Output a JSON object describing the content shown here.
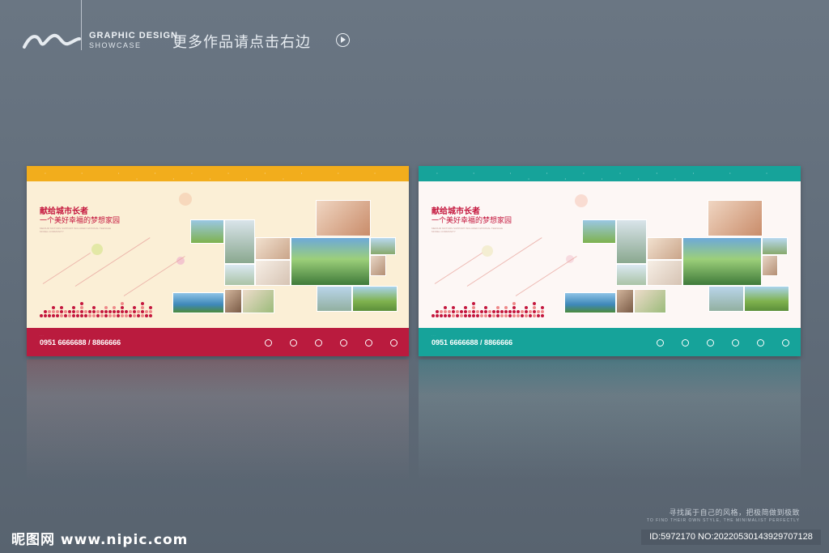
{
  "header": {
    "brand_line1": "GRAPHIC DESIGN",
    "brand_line2": "SHOWCASE",
    "more_text": "更多作品请点击右边"
  },
  "boards": [
    {
      "variant": "warm",
      "title_line1": "献给城市长者",
      "title_line2": "一个美好幸福的梦想家园",
      "subtitle": "MEDIUM MOTORS SUPPORT INCLUDED NATIONAL TEENAGE MODEL COMMUNITY",
      "phone": "0951 6666688 / 8866666",
      "accent": "#ba1b3e",
      "top_color": "#f2ad1c"
    },
    {
      "variant": "teal",
      "title_line1": "献给城市长者",
      "title_line2": "一个美好幸福的梦想家园",
      "subtitle": "MEDIUM MOTORS SUPPORT INCLUDED NATIONAL TEENAGE MODEL COMMUNITY",
      "phone": "0951 6666688 / 8866666",
      "accent": "#16a39a",
      "top_color": "#16a39a"
    }
  ],
  "footer": {
    "slogan_cn": "寻找属于自己的风格，把极简做到极致",
    "slogan_en": "TO FIND THEIR OWN STYLE, THE MINIMALIST PERFECTLY",
    "watermark": "昵图网 www.nipic.com",
    "id_text": "ID:5972170 NO:20220530143929707128"
  }
}
